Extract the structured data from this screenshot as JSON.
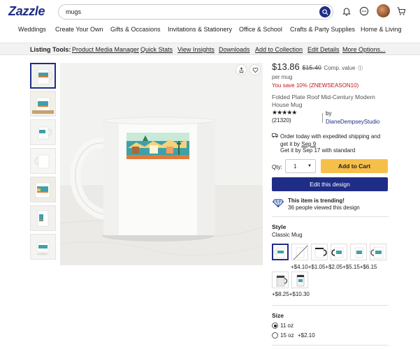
{
  "header": {
    "logo": "Zazzle",
    "search_value": "mugs",
    "icons": [
      "search-icon",
      "bell-icon",
      "chat-icon",
      "avatar",
      "cart-icon"
    ]
  },
  "nav": [
    "Weddings",
    "Create Your Own",
    "Gifts & Occasions",
    "Invitations & Stationery",
    "Office & School",
    "Crafts & Party Supplies",
    "Home & Living"
  ],
  "listing_tools": {
    "label": "Listing Tools:",
    "items": [
      "Product Media Manager",
      "Quick Stats",
      "View Insights",
      "Downloads",
      "Add to Collection",
      "Edit Details",
      "More Options..."
    ]
  },
  "product": {
    "price": "$13.86",
    "compare_price": "$15.40",
    "compare_label": "Comp. value",
    "per_unit": "per mug",
    "savings": "You save 10% (ZNEWSEASON10)",
    "title": "Folded Plate Roof Mid-Century Modern House Mug",
    "rating_stars": "★★★★★",
    "review_count": "(21320)",
    "by_label": "by",
    "creator": "DianeDempseyStudio",
    "shipping_line1": "Order today with expedited shipping and get it by",
    "shipping_date": "Sep 9",
    "shipping_line2": "Get it by Sep 17 with standard",
    "qty_label": "Qty:",
    "qty_value": "1",
    "add_to_cart": "Add to Cart",
    "edit_design": "Edit this design",
    "trending_title": "This item is trending!",
    "trending_sub": "36 people viewed this design"
  },
  "style": {
    "label": "Style",
    "selected": "Classic Mug",
    "price_row1": [
      "+$4.10",
      "+$1.05",
      "+$2.05",
      "+$5.15",
      "+$6.15"
    ],
    "price_row2": [
      "+$8.25",
      "+$10.30"
    ]
  },
  "size": {
    "label": "Size",
    "options": [
      {
        "label": "11 oz",
        "extra": "",
        "selected": true
      },
      {
        "label": "15 oz",
        "extra": "+$2.10",
        "selected": false
      }
    ]
  },
  "colors": {
    "brand": "#1f2d87",
    "add_to_cart": "#f6bf4a",
    "savings": "#c4151c"
  }
}
